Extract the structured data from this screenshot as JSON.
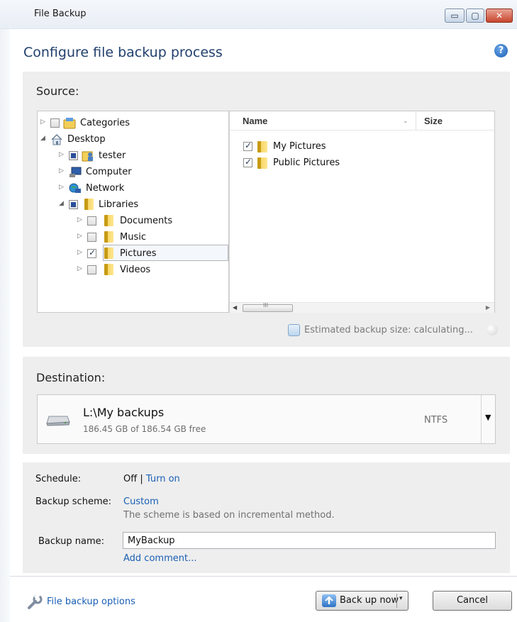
{
  "window": {
    "title": "File Backup",
    "controls": {
      "minimize": "▭",
      "maximize": "▢",
      "close": "✕"
    }
  },
  "heading": "Configure file backup process",
  "help": "?",
  "source": {
    "label": "Source:",
    "tree": [
      {
        "label": "Categories",
        "expander": "▷",
        "check": "unchecked",
        "icon": "categories-icon"
      },
      {
        "label": "Desktop",
        "expander": "◢",
        "check": "none",
        "icon": "home-icon"
      },
      {
        "label": "tester",
        "expander": "▷",
        "check": "partial",
        "icon": "user-folder-icon"
      },
      {
        "label": "Computer",
        "expander": "▷",
        "check": "none",
        "icon": "computer-icon"
      },
      {
        "label": "Network",
        "expander": "▷",
        "check": "none",
        "icon": "network-icon"
      },
      {
        "label": "Libraries",
        "expander": "◢",
        "check": "partial",
        "icon": "library-icon"
      },
      {
        "label": "Documents",
        "expander": "▷",
        "check": "unchecked",
        "icon": "folder-icon"
      },
      {
        "label": "Music",
        "expander": "▷",
        "check": "unchecked",
        "icon": "folder-icon"
      },
      {
        "label": "Pictures",
        "expander": "▷",
        "check": "checked",
        "icon": "folder-icon",
        "selected": true
      },
      {
        "label": "Videos",
        "expander": "▷",
        "check": "unchecked",
        "icon": "folder-icon"
      }
    ],
    "columns": {
      "name": "Name",
      "size": "Size",
      "sort_glyph": "⌄"
    },
    "files": [
      {
        "name": "My Pictures",
        "checked": true
      },
      {
        "name": "Public Pictures",
        "checked": true
      }
    ],
    "scrollbar": {
      "left": "◀",
      "right": "▶",
      "grip": "III"
    },
    "estimated": "Estimated backup size: calculating..."
  },
  "destination": {
    "label": "Destination:",
    "path": "L:\\My backups",
    "free": "186.45 GB of 186.54 GB free",
    "fs": "NTFS",
    "arrow": "▼"
  },
  "options": {
    "schedule_label": "Schedule:",
    "schedule_value": "Off",
    "schedule_sep": "|",
    "schedule_link": "Turn on",
    "scheme_label": "Backup scheme:",
    "scheme_link": "Custom",
    "scheme_hint": "The scheme is based on incremental method.",
    "name_label": "Backup name:",
    "name_value": "MyBackup",
    "comment_link": "Add comment..."
  },
  "footer": {
    "options_link": "File backup options",
    "backup_button": "Back up now",
    "dropdown": "▾",
    "cancel_button": "Cancel"
  },
  "colors": {
    "accent": "#1a5fb4",
    "heading": "#22406e",
    "panel": "#eeeeee"
  }
}
